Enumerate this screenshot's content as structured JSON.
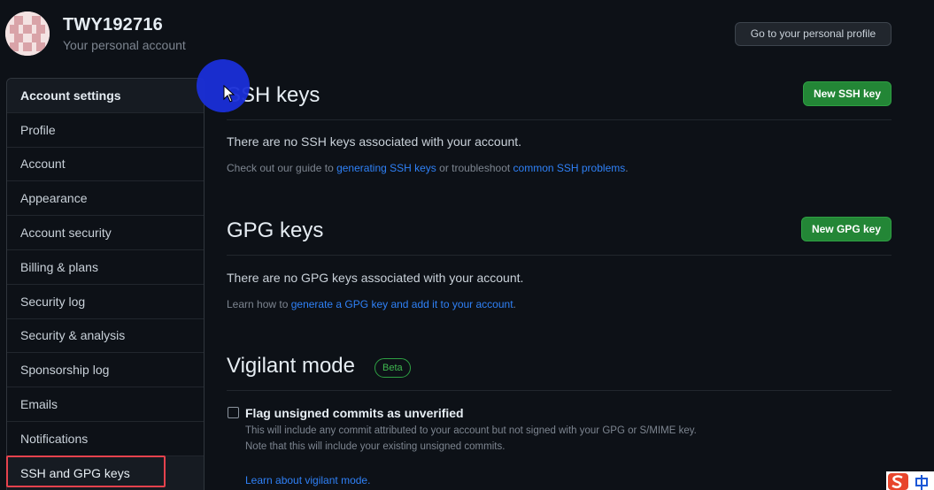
{
  "header": {
    "username": "TWY192716",
    "account_type": "Your personal account",
    "profile_button": "Go to your personal profile"
  },
  "sidebar": {
    "heading": "Account settings",
    "items": [
      {
        "label": "Profile"
      },
      {
        "label": "Account"
      },
      {
        "label": "Appearance"
      },
      {
        "label": "Account security"
      },
      {
        "label": "Billing & plans"
      },
      {
        "label": "Security log"
      },
      {
        "label": "Security & analysis"
      },
      {
        "label": "Sponsorship log"
      },
      {
        "label": "Emails"
      },
      {
        "label": "Notifications"
      },
      {
        "label": "SSH and GPG keys"
      }
    ],
    "selected": "SSH and GPG keys"
  },
  "ssh": {
    "title": "SSH keys",
    "new_button": "New SSH key",
    "empty_message": "There are no SSH keys associated with your account.",
    "help_prefix": "Check out our guide to ",
    "help_link1": "generating SSH keys",
    "help_middle": " or troubleshoot ",
    "help_link2": "common SSH problems",
    "help_suffix": "."
  },
  "gpg": {
    "title": "GPG keys",
    "new_button": "New GPG key",
    "empty_message": "There are no GPG keys associated with your account.",
    "help_prefix": "Learn how to ",
    "help_link": "generate a GPG key and add it to your account",
    "help_suffix": "."
  },
  "vigilant": {
    "title": "Vigilant mode",
    "badge": "Beta",
    "checkbox_label": "Flag unsigned commits as unverified",
    "checked": false,
    "note1": "This will include any commit attributed to your account but not signed with your GPG or S/MIME key.",
    "note2": "Note that this will include your existing unsigned commits.",
    "learn_link": "Learn about vigilant mode."
  },
  "colors": {
    "background": "#0d1117",
    "accent_green": "#238636",
    "link_blue": "#2f81f7",
    "selection_outline": "#e5424d",
    "cursor_halo": "#1a2fd8"
  },
  "icons": {
    "avatar": "identicon-avatar",
    "cursor": "mouse-pointer-icon",
    "ime": "sogou-ime-icon"
  }
}
